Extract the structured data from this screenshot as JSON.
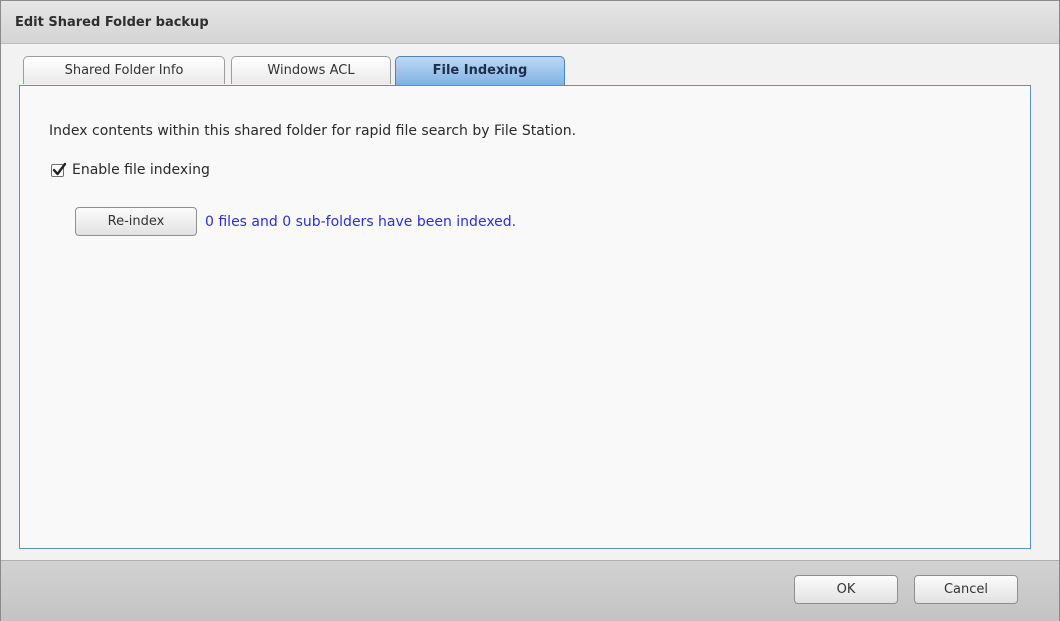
{
  "window": {
    "title": "Edit Shared Folder backup"
  },
  "tabs": [
    {
      "label": "Shared Folder Info",
      "active": false
    },
    {
      "label": "Windows ACL",
      "active": false
    },
    {
      "label": "File Indexing",
      "active": true
    }
  ],
  "file_indexing": {
    "description": "Index contents within this shared folder for rapid file search by File Station.",
    "enable_label": "Enable file indexing",
    "enable_checked": true,
    "reindex_label": "Re-index",
    "status_text": "0 files and 0 sub-folders have been indexed."
  },
  "footer": {
    "ok_label": "OK",
    "cancel_label": "Cancel"
  },
  "colors": {
    "active_tab": "#7fb1e3",
    "panel_border": "#5a8fc8",
    "status_text": "#2d2ddc"
  },
  "icons": {
    "checkbox": "checkmark-icon"
  }
}
